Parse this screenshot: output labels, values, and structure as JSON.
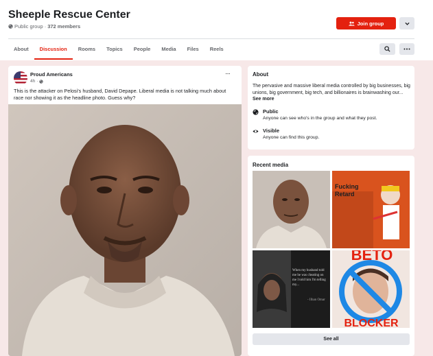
{
  "header": {
    "title": "Sheeple Rescue Center",
    "privacy": "Public group",
    "separator": "·",
    "members": "372 members",
    "join_label": "Join group"
  },
  "tabs": [
    {
      "label": "About"
    },
    {
      "label": "Discussion",
      "active": true
    },
    {
      "label": "Rooms"
    },
    {
      "label": "Topics"
    },
    {
      "label": "People"
    },
    {
      "label": "Media"
    },
    {
      "label": "Files"
    },
    {
      "label": "Reels"
    }
  ],
  "post": {
    "author": "Proud Americans",
    "time": "4h",
    "separator": "·",
    "more": "···",
    "text": "This is the attacker on Pelosi's husband, David Depape. Liberal media is not talking much about race nor showing it as the headline photo. Guess why?"
  },
  "about": {
    "heading": "About",
    "description": "The pervasive and massive liberal media controlled by big businesses, big unions, big government, big tech, and billionaires is brainwashing our...",
    "see_more": "See more",
    "public_title": "Public",
    "public_sub": "Anyone can see who's in the group and what they post.",
    "visible_title": "Visible",
    "visible_sub": "Anyone can find this group."
  },
  "media": {
    "heading": "Recent media",
    "see_all": "See all",
    "thumb2_text": "Fucking Retard",
    "thumb3_text": "When my husband told me he was cheating on me I told him I'm telling my...",
    "thumb3_sig": "- Ilhan Omar",
    "thumb4_text": "BETO",
    "thumb4_bottom": "BLOCKER"
  },
  "colors": {
    "accent": "#e4210f",
    "page_bg": "#f7e8e8",
    "button_gray": "#e4e6eb"
  }
}
